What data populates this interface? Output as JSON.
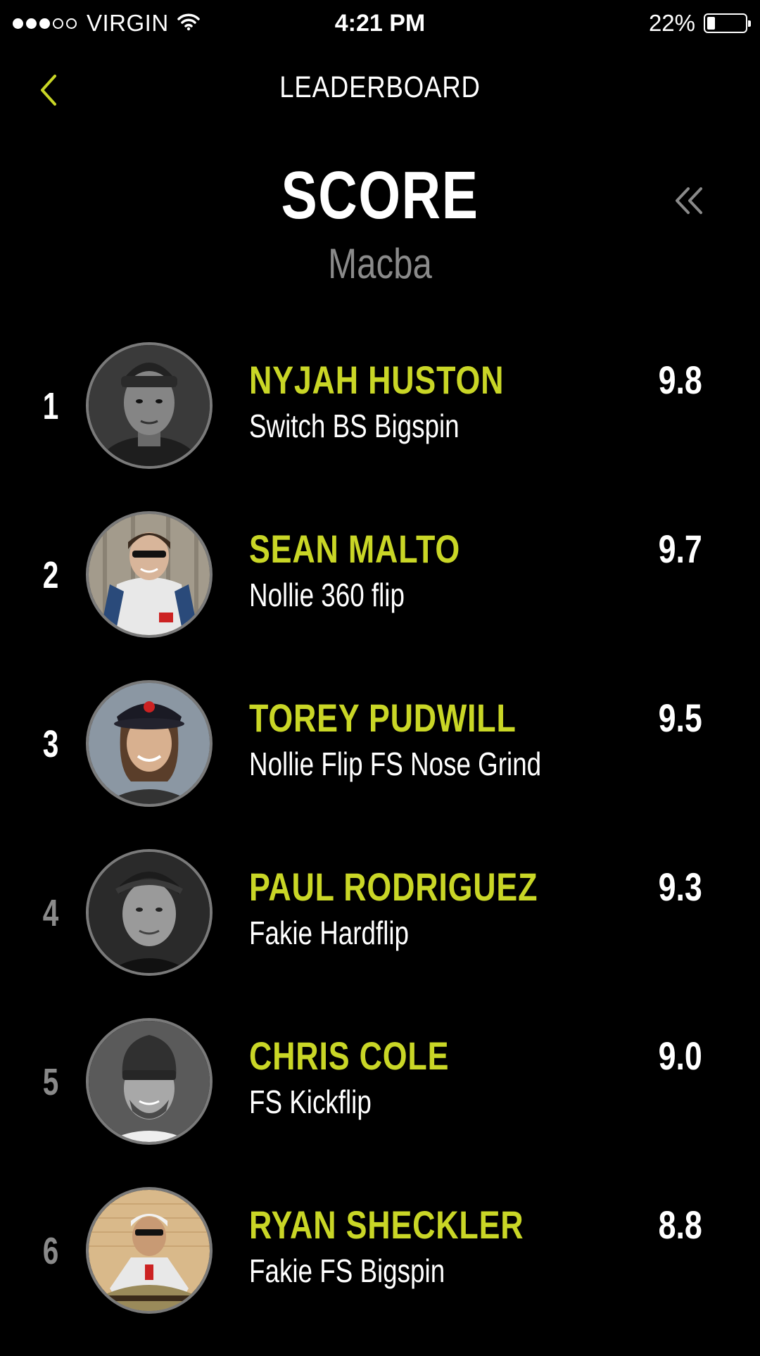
{
  "status_bar": {
    "carrier": "VIRGIN",
    "time": "4:21 PM",
    "battery_percent": "22%",
    "battery_level": 0.22,
    "signal_filled": 3,
    "signal_total": 5
  },
  "nav": {
    "title": "LEADERBOARD",
    "back_icon": "chevron-left-icon"
  },
  "header": {
    "title": "SCORE",
    "subtitle": "Macba",
    "collapse_icon": "double-chevron-left-icon"
  },
  "colors": {
    "accent": "#c9d626",
    "background": "#000000",
    "dim_text": "#8a8a8a"
  },
  "leaderboard": [
    {
      "rank": "1",
      "name": "NYJAH HUSTON",
      "trick": "Switch BS Bigspin",
      "score": "9.8",
      "rank_dim": false
    },
    {
      "rank": "2",
      "name": "SEAN MALTO",
      "trick": "Nollie 360 flip",
      "score": "9.7",
      "rank_dim": false
    },
    {
      "rank": "3",
      "name": "TOREY PUDWILL",
      "trick": "Nollie Flip FS Nose Grind",
      "score": "9.5",
      "rank_dim": false
    },
    {
      "rank": "4",
      "name": "PAUL RODRIGUEZ",
      "trick": "Fakie Hardflip",
      "score": "9.3",
      "rank_dim": true
    },
    {
      "rank": "5",
      "name": "CHRIS COLE",
      "trick": "FS Kickflip",
      "score": "9.0",
      "rank_dim": true
    },
    {
      "rank": "6",
      "name": "RYAN SHECKLER",
      "trick": "Fakie FS  Bigspin",
      "score": "8.8",
      "rank_dim": true
    }
  ]
}
